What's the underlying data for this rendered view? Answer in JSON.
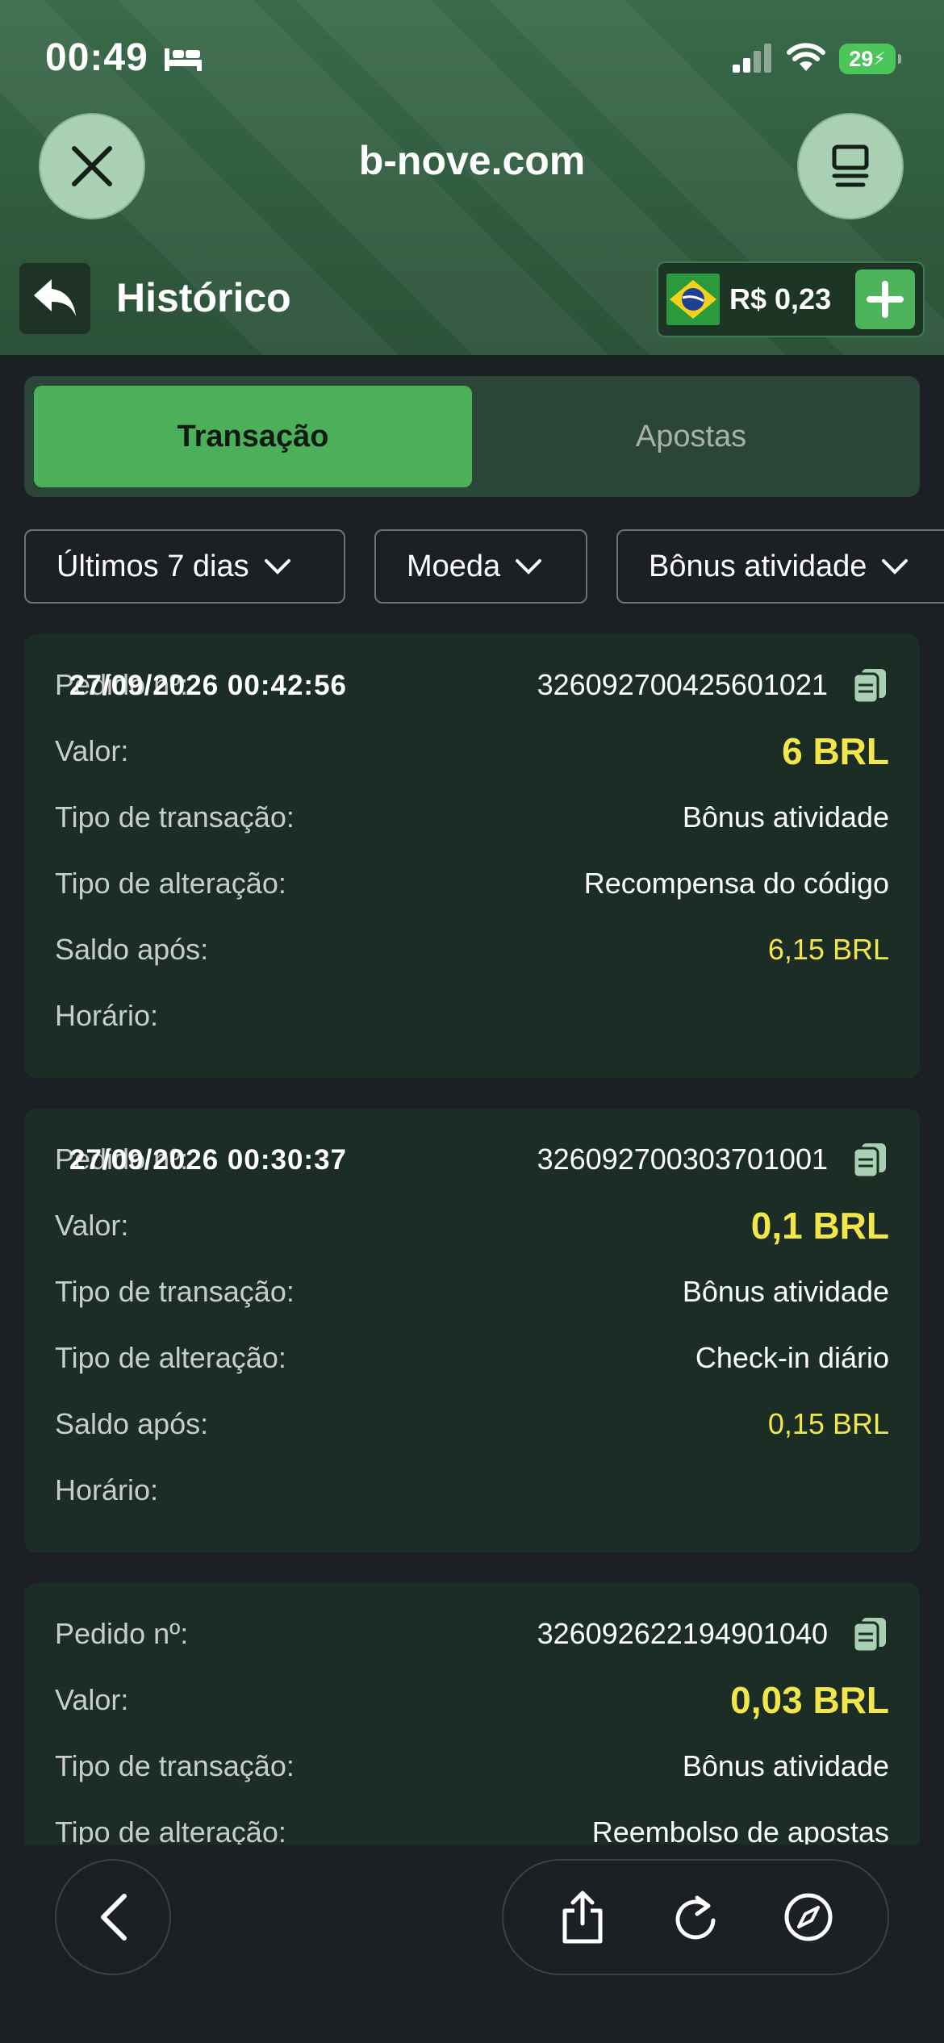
{
  "status_bar": {
    "time": "00:49",
    "battery": "29"
  },
  "browser": {
    "site": "b-nove.com"
  },
  "header": {
    "title": "Histórico",
    "balance": "R$ 0,23"
  },
  "tabs": [
    {
      "label": "Transação",
      "active": true
    },
    {
      "label": "Apostas",
      "active": false
    }
  ],
  "filters": {
    "period": "Últimos 7 dias",
    "currency": "Moeda",
    "type": "Bônus atividade"
  },
  "field_labels": {
    "order": "Pedido nº:",
    "value": "Valor:",
    "transaction_type": "Tipo de transação:",
    "change_type": "Tipo de alteração:",
    "balance_after": "Saldo após:",
    "time": "Horário:"
  },
  "transactions": [
    {
      "order": "326092700425601021",
      "value": "6 BRL",
      "transaction_type": "Bônus atividade",
      "change_type": "Recompensa do código",
      "balance_after": "6,15 BRL",
      "time": "27/09/2026 00:42:56"
    },
    {
      "order": "326092700303701001",
      "value": "0,1 BRL",
      "transaction_type": "Bônus atividade",
      "change_type": "Check-in diário",
      "balance_after": "0,15 BRL",
      "time": "27/09/2026 00:30:37"
    },
    {
      "order": "326092622194901040",
      "value": "0,03 BRL",
      "transaction_type": "Bônus atividade",
      "change_type": "Reembolso de apostas"
    }
  ],
  "colors": {
    "accent_green": "#4caf5a",
    "amount_yellow": "#f2e64a",
    "card_bg": "#1b2d24"
  }
}
